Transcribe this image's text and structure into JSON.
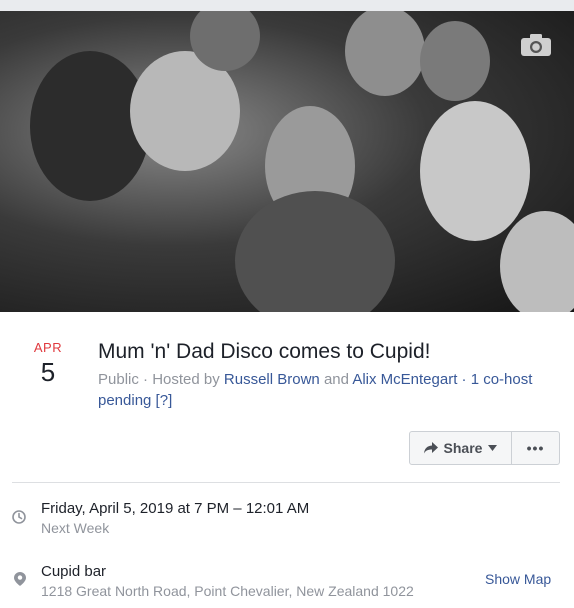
{
  "cover": {
    "alt_icon": "camera-icon"
  },
  "event": {
    "month": "APR",
    "day": "5",
    "title": "Mum 'n' Dad Disco comes to Cupid!",
    "privacy": "Public",
    "hosted_by_prefix": " · Hosted by ",
    "host1": "Russell Brown",
    "and_text": " and ",
    "host2": "Alix McEntegart",
    "cohost_pending": "· 1 co-host pending [?]"
  },
  "actions": {
    "share_label": "Share",
    "more_label": "•••"
  },
  "time": {
    "main": "Friday, April 5, 2019 at 7 PM – 12:01 AM",
    "sub": "Next Week"
  },
  "location": {
    "name": "Cupid bar",
    "address": "1218 Great North Road, Point Chevalier, New Zealand 1022",
    "map_link": "Show Map"
  },
  "colors": {
    "month": "#e0393e",
    "link": "#385898",
    "muted": "#90949c"
  }
}
